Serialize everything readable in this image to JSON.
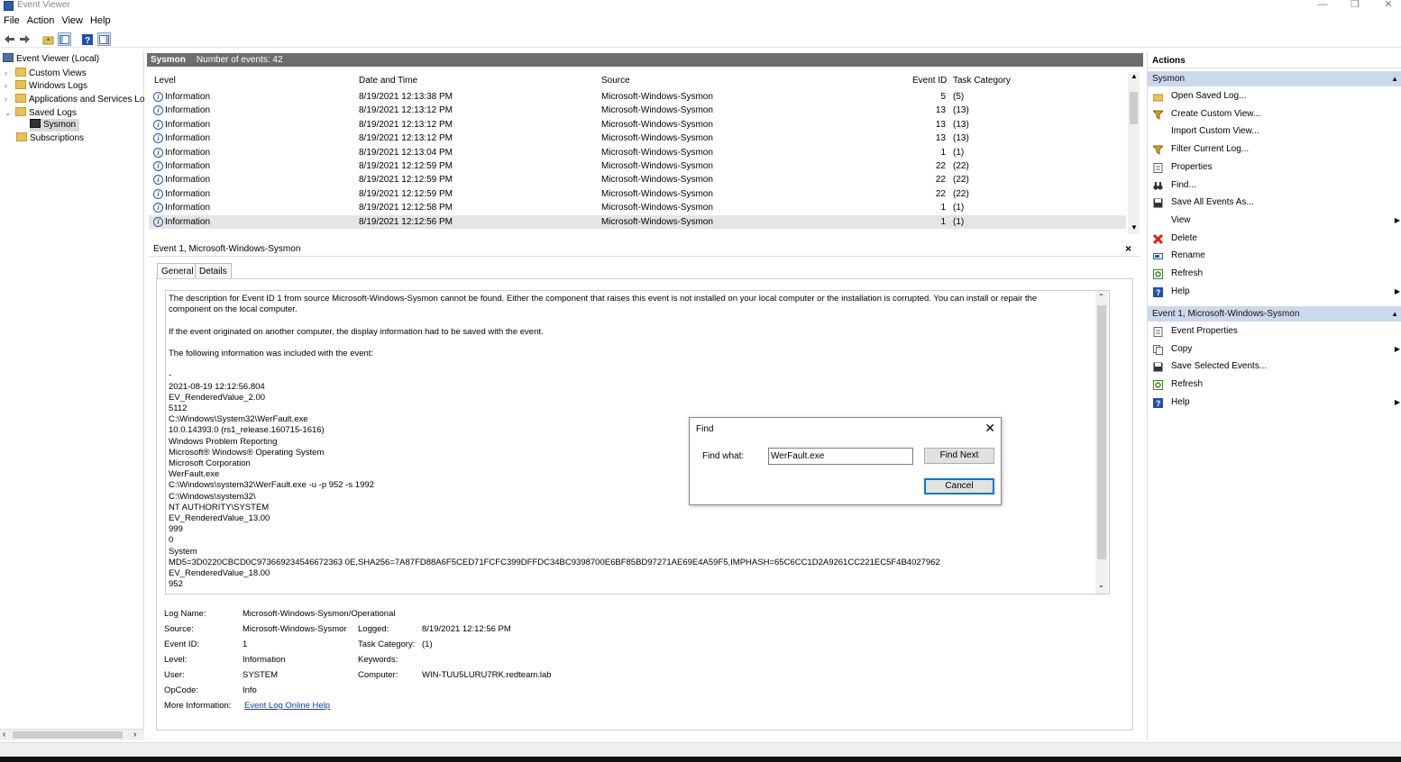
{
  "window": {
    "title": "Event Viewer",
    "minimize": "—",
    "restore": "❐",
    "close": "✕"
  },
  "menu": [
    "File",
    "Action",
    "View",
    "Help"
  ],
  "tree": {
    "root": "Event Viewer (Local)",
    "custom_views": "Custom Views",
    "windows_logs": "Windows Logs",
    "app_services": "Applications and Services Lo",
    "saved_logs": "Saved Logs",
    "sysmon": "Sysmon",
    "subscriptions": "Subscriptions"
  },
  "grid": {
    "log_name": "Sysmon",
    "count_text": "Number of events: 42",
    "columns": {
      "level": "Level",
      "datetime": "Date and Time",
      "source": "Source",
      "event_id": "Event ID",
      "task": "Task Category"
    },
    "rows": [
      {
        "level": "Information",
        "datetime": "8/19/2021 12:13:38 PM",
        "source": "Microsoft-Windows-Sysmon",
        "event_id": "5",
        "task": "(5)"
      },
      {
        "level": "Information",
        "datetime": "8/19/2021 12:13:12 PM",
        "source": "Microsoft-Windows-Sysmon",
        "event_id": "13",
        "task": "(13)"
      },
      {
        "level": "Information",
        "datetime": "8/19/2021 12:13:12 PM",
        "source": "Microsoft-Windows-Sysmon",
        "event_id": "13",
        "task": "(13)"
      },
      {
        "level": "Information",
        "datetime": "8/19/2021 12:13:12 PM",
        "source": "Microsoft-Windows-Sysmon",
        "event_id": "13",
        "task": "(13)"
      },
      {
        "level": "Information",
        "datetime": "8/19/2021 12:13:04 PM",
        "source": "Microsoft-Windows-Sysmon",
        "event_id": "1",
        "task": "(1)"
      },
      {
        "level": "Information",
        "datetime": "8/19/2021 12:12:59 PM",
        "source": "Microsoft-Windows-Sysmon",
        "event_id": "22",
        "task": "(22)"
      },
      {
        "level": "Information",
        "datetime": "8/19/2021 12:12:59 PM",
        "source": "Microsoft-Windows-Sysmon",
        "event_id": "22",
        "task": "(22)"
      },
      {
        "level": "Information",
        "datetime": "8/19/2021 12:12:59 PM",
        "source": "Microsoft-Windows-Sysmon",
        "event_id": "22",
        "task": "(22)"
      },
      {
        "level": "Information",
        "datetime": "8/19/2021 12:12:58 PM",
        "source": "Microsoft-Windows-Sysmon",
        "event_id": "1",
        "task": "(1)"
      },
      {
        "level": "Information",
        "datetime": "8/19/2021 12:12:56 PM",
        "source": "Microsoft-Windows-Sysmon",
        "event_id": "1",
        "task": "(1)"
      }
    ]
  },
  "detail": {
    "header": "Event 1, Microsoft-Windows-Sysmon",
    "close": "×",
    "tabs": [
      "General",
      "Details"
    ],
    "description": "The description for Event ID 1 from source Microsoft-Windows-Sysmon cannot be found. Either the component that raises this event is not installed on your local computer or the installation is corrupted. You can install or repair the\ncomponent on the local computer.\n\nIf the event originated on another computer, the display information had to be saved with the event.\n\nThe following information was included with the event:\n\n-\n2021-08-19 12:12:56.804\nEV_RenderedValue_2.00\n5112\nC:\\Windows\\System32\\WerFault.exe\n10.0.14393.0 (rs1_release.160715-1616)\nWindows Problem Reporting\nMicrosoft® Windows® Operating System\nMicrosoft Corporation\nWerFault.exe\nC:\\Windows\\system32\\WerFault.exe -u -p 952 -s 1992\nC:\\Windows\\system32\\\nNT AUTHORITY\\SYSTEM\nEV_RenderedValue_13.00\n999\n0\nSystem\nMD5=3D0220CBCD0C973669234546672363 0E,SHA256=7A87FD88A6F5CED71FCFC399DFFDC34BC9398700E6BF85BD97271AE69E4A59F5,IMPHASH=65C6CC1D2A9261CC221EC5F4B4027962\nEV_RenderedValue_18.00\n952",
    "fields": {
      "log_name_label": "Log Name:",
      "log_name": "Microsoft-Windows-Sysmon/Operational",
      "source_label": "Source:",
      "source": "Microsoft-Windows-Sysmor",
      "logged_label": "Logged:",
      "logged": "8/19/2021 12:12:56 PM",
      "event_id_label": "Event ID:",
      "event_id": "1",
      "task_label": "Task Category:",
      "task": "(1)",
      "level_label": "Level:",
      "level": "Information",
      "keywords_label": "Keywords:",
      "user_label": "User:",
      "user": "SYSTEM",
      "computer_label": "Computer:",
      "computer": "WIN-TUU5LURU7RK.redteam.lab",
      "opcode_label": "OpCode:",
      "opcode": "Info",
      "more_info_label": "More Information:",
      "more_info_link": "Event Log Online Help"
    }
  },
  "actions": {
    "header": "Actions",
    "section1": "Sysmon",
    "items1": [
      {
        "label": "Open Saved Log...",
        "icon": "folder-open-icon"
      },
      {
        "label": "Create Custom View...",
        "icon": "filter-icon"
      },
      {
        "label": "Import Custom View...",
        "icon": "none"
      },
      {
        "label": "Filter Current Log...",
        "icon": "filter-icon"
      },
      {
        "label": "Properties",
        "icon": "properties-icon"
      },
      {
        "label": "Find...",
        "icon": "binoculars-icon"
      },
      {
        "label": "Save All Events As...",
        "icon": "save-icon"
      },
      {
        "label": "View",
        "icon": "none",
        "submenu": true
      },
      {
        "label": "Delete",
        "icon": "delete-icon"
      },
      {
        "label": "Rename",
        "icon": "rename-icon"
      },
      {
        "label": "Refresh",
        "icon": "refresh-icon"
      },
      {
        "label": "Help",
        "icon": "help-icon",
        "submenu": true
      }
    ],
    "section2": "Event 1, Microsoft-Windows-Sysmon",
    "items2": [
      {
        "label": "Event Properties",
        "icon": "properties-icon"
      },
      {
        "label": "Copy",
        "icon": "copy-icon",
        "submenu": true
      },
      {
        "label": "Save Selected Events...",
        "icon": "save-icon"
      },
      {
        "label": "Refresh",
        "icon": "refresh-icon"
      },
      {
        "label": "Help",
        "icon": "help-icon",
        "submenu": true
      }
    ]
  },
  "find_dialog": {
    "title": "Find",
    "label": "Find what:",
    "value": "WerFault.exe",
    "find_next": "Find Next",
    "cancel": "Cancel"
  },
  "colors": {
    "accent": "#0078d7",
    "section_bg": "#ccd9ec",
    "header_bg": "#6d6d6d"
  }
}
